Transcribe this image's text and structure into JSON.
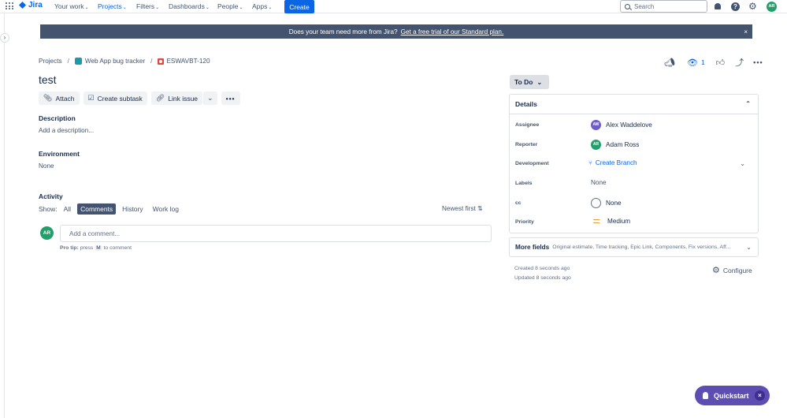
{
  "topnav": {
    "logo": "Jira",
    "items": [
      "Your work",
      "Projects",
      "Filters",
      "Dashboards",
      "People",
      "Apps"
    ],
    "create_label": "Create",
    "search_placeholder": "Search",
    "avatar_initials": "AR"
  },
  "banner": {
    "text": "Does your team need more from Jira?",
    "link": "Get a free trial of our Standard plan.",
    "close": "×"
  },
  "breadcrumb": {
    "projects": "Projects",
    "project": "Web App bug tracker",
    "issue_key": "ESWAVBT-120"
  },
  "issue": {
    "title": "test",
    "actions": {
      "attach": "Attach",
      "create_subtask": "Create subtask",
      "link_issue": "Link issue",
      "more": "•••"
    },
    "description_h": "Description",
    "description_placeholder": "Add a description...",
    "environment_h": "Environment",
    "environment_val": "None"
  },
  "activity": {
    "heading": "Activity",
    "show_label": "Show:",
    "tabs": [
      "All",
      "Comments",
      "History",
      "Work log"
    ],
    "active_tab": "Comments",
    "sort": "Newest first",
    "comment_avatar": "AR",
    "comment_placeholder": "Add a comment...",
    "protip_bold": "Pro tip:",
    "protip_text1": "press",
    "protip_key": "M",
    "protip_text2": "to comment"
  },
  "header_right": {
    "watch_count": "1"
  },
  "status": {
    "label": "To Do"
  },
  "details": {
    "heading": "Details",
    "assignee_label": "Assignee",
    "assignee_initials": "AW",
    "assignee": "Alex Waddelove",
    "reporter_label": "Reporter",
    "reporter_initials": "AR",
    "reporter": "Adam Ross",
    "development_label": "Development",
    "development": "Create Branch",
    "labels_label": "Labels",
    "labels": "None",
    "cc_label": "cc",
    "cc": "None",
    "priority_label": "Priority",
    "priority": "Medium"
  },
  "more_fields": {
    "title": "More fields",
    "subtitle": "Original estimate, Time tracking, Epic Link, Components, Fix versions, Aff..."
  },
  "meta": {
    "created": "Created 8 seconds ago",
    "updated": "Updated 8 seconds ago",
    "configure": "Configure"
  },
  "quickstart": {
    "label": "Quickstart"
  },
  "colors": {
    "brand": "#0c66e4",
    "banner_bg": "#44546f",
    "quickstart_bg": "#5e4db2",
    "avatar_green": "#22a06b",
    "avatar_purple": "#6e5dc6"
  }
}
